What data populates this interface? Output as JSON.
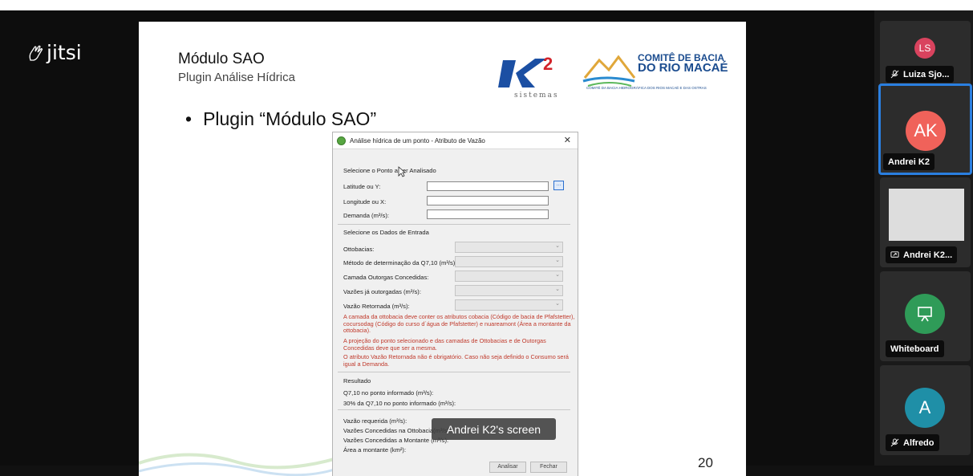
{
  "app": {
    "brand": "jitsi"
  },
  "slide": {
    "title": "Módulo SAO",
    "subtitle": "Plugin Análise Hídrica",
    "bullet": "Plugin “Módulo SAO”",
    "page_number": "20",
    "logos": {
      "k2_text": "sistemas",
      "comite_line1": "COMITÊ DE BACIA",
      "comite_line2": "DO RIO MACAÉ",
      "comite_line3": "COMITÊ DA BACIA HIDROGRÁFICA DOS RIOS MACAÉ E DAS OSTRAS"
    }
  },
  "dialog": {
    "title": "Análise hídrica de um ponto - Atributo de Vazão",
    "section_point": "Selecione o Ponto a ser Analisado",
    "latitude_label": "Latitude ou Y:",
    "longitude_label": "Longitude ou X:",
    "demand_label": "Demanda (m³/s):",
    "browse_label": "...",
    "section_input": "Selecione os Dados de Entrada",
    "ottobacias_label": "Ottobacias:",
    "metodo_label": "Método de determinação da Q7,10 (m³/s):",
    "camada_label": "Camada Outorgas Concedidas:",
    "vazoes_label": "Vazões já outorgadas (m³/s):",
    "retornada_label": "Vazão Retornada (m³/s):",
    "warn1": "A camada da ottobacia deve conter os atributos cobacia (Código de bacia de Pfafstetter), cocursodag (Código do curso d´água de Pfafstetter) e nuareamont (Área a montante da ottobacia).",
    "warn2": "A projeção do ponto selecionado e das camadas de Ottobacias e de Outorgas Concedidas deve que ser a mesma.",
    "warn3": "O atributo Vazão Retornada não é obrigatório. Caso não seja definido o Consumo será igual a Demanda.",
    "result_label": "Resultado",
    "q710_label": "Q7,10 no ponto informado (m³/s):",
    "pct_label": "30% da Q7,10 no ponto informado (m³/s):",
    "requerida_label": "Vazão requerida (m³/s):",
    "concedidas_otto_label": "Vazões Concedidas na Ottobacia(m³/s):",
    "concedidas_mont_label": "Vazões Concedidas a Montante (m³/s):",
    "area_label": "Área a montante (km²):",
    "analisar_btn": "Analisar",
    "fechar_btn": "Fechar"
  },
  "screen_label": "Andrei K2's screen",
  "participants": [
    {
      "initials": "LS",
      "name": "Luiza Sjo...",
      "color": "#d9435e",
      "muted": true
    },
    {
      "initials": "AK",
      "name": "Andrei K2",
      "color": "#f0625a",
      "muted": false,
      "active": true
    },
    {
      "initials": "",
      "name": "Andrei K2...",
      "screen_share": true
    },
    {
      "initials": "",
      "name": "Whiteboard",
      "color": "#2f9b58"
    },
    {
      "initials": "A",
      "name": "Alfredo",
      "color": "#1f8fa7",
      "muted": true
    }
  ]
}
